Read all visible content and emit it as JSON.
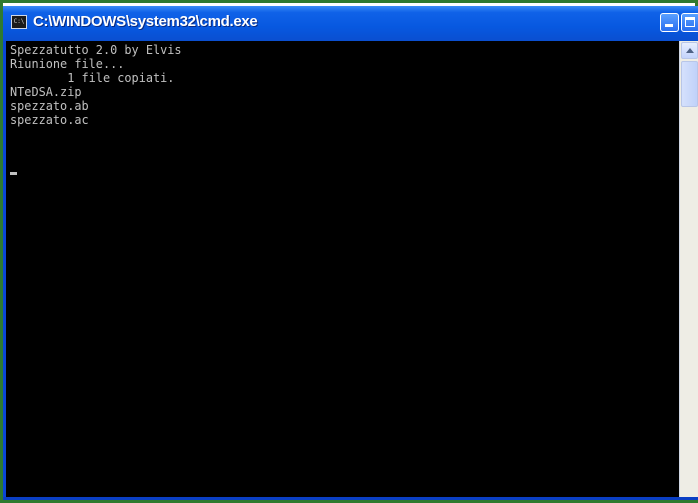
{
  "window": {
    "title": "C:\\WINDOWS\\system32\\cmd.exe",
    "icon": "cmd-icon",
    "icon_text": "C:\\"
  },
  "controls": {
    "minimize": "minimize-icon",
    "maximize": "maximize-icon"
  },
  "console": {
    "lines": [
      "Spezzatutto 2.0 by Elvis",
      "Riunione file...",
      "        1 file copiati.",
      "NTeDSA.zip",
      "spezzato.ab",
      "spezzato.ac"
    ]
  },
  "colors": {
    "titlebar": "#0758e0",
    "console_bg": "#000000",
    "console_text": "#c0c0c0",
    "frame": "#2f7a2f"
  }
}
